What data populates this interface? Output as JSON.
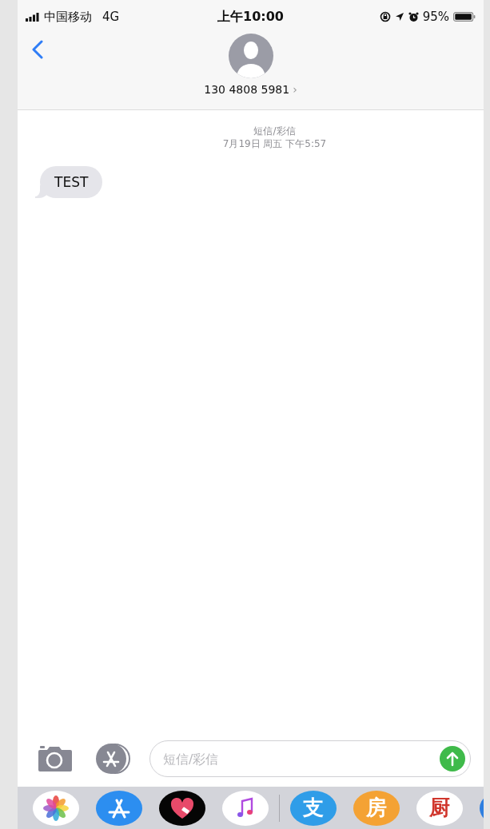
{
  "status_bar": {
    "carrier": "中国移动",
    "network": "4G",
    "time": "上午10:00",
    "battery_text": "95%"
  },
  "header": {
    "contact": "130 4808 5981",
    "chevron": "›"
  },
  "conversation": {
    "service": "短信/彩信",
    "timestamp": "7月19日 周五 下午5:57",
    "messages": [
      {
        "text": "TEST",
        "incoming": true
      }
    ]
  },
  "composer": {
    "placeholder": "短信/彩信"
  },
  "app_drawer": [
    {
      "kind": "photos"
    },
    {
      "kind": "appstore"
    },
    {
      "kind": "heart"
    },
    {
      "kind": "music"
    },
    {
      "kind": "glyph",
      "glyph": "支",
      "color": "#2f9de8"
    },
    {
      "kind": "glyph",
      "glyph": "房",
      "color": "#f4a234"
    },
    {
      "kind": "glyph",
      "glyph": "厨",
      "color": "#ffffff"
    },
    {
      "kind": "blank",
      "color": "#2f7fe0"
    }
  ]
}
